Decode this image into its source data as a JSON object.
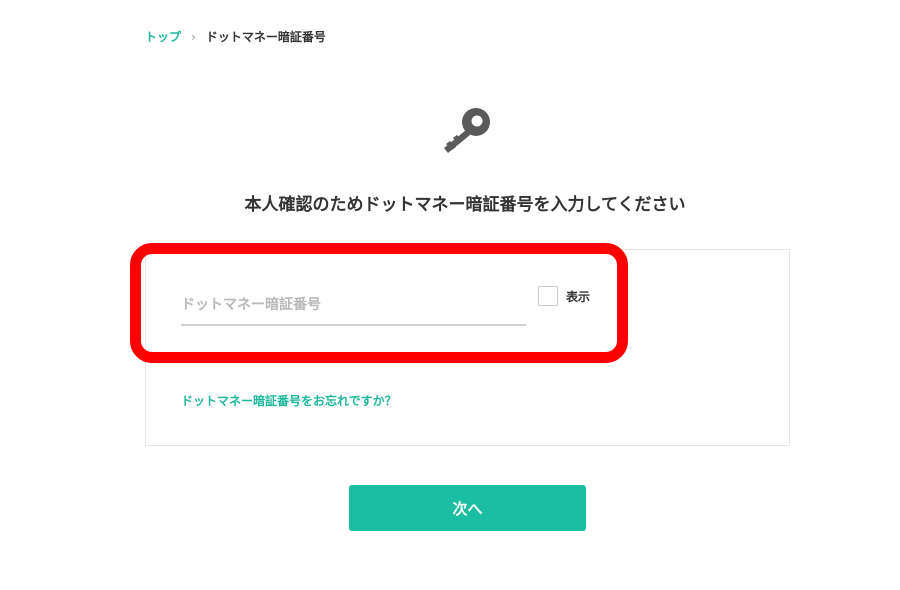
{
  "breadcrumb": {
    "home_label": "トップ",
    "separator": "›",
    "current_label": "ドットマネー暗証番号"
  },
  "header": {
    "icon": "key-icon",
    "title": "本人確認のためドットマネー暗証番号を入力してください"
  },
  "form": {
    "pin_input": {
      "value": "",
      "placeholder": "ドットマネー暗証番号"
    },
    "show_toggle": {
      "label": "表示",
      "checked": false
    },
    "forgot_link": "ドットマネー暗証番号をお忘れですか？"
  },
  "actions": {
    "next_label": "次へ"
  },
  "colors": {
    "accent": "#1bbea2",
    "link": "#1bb89d",
    "highlight": "#ff0000",
    "icon": "#5a5a5a"
  }
}
